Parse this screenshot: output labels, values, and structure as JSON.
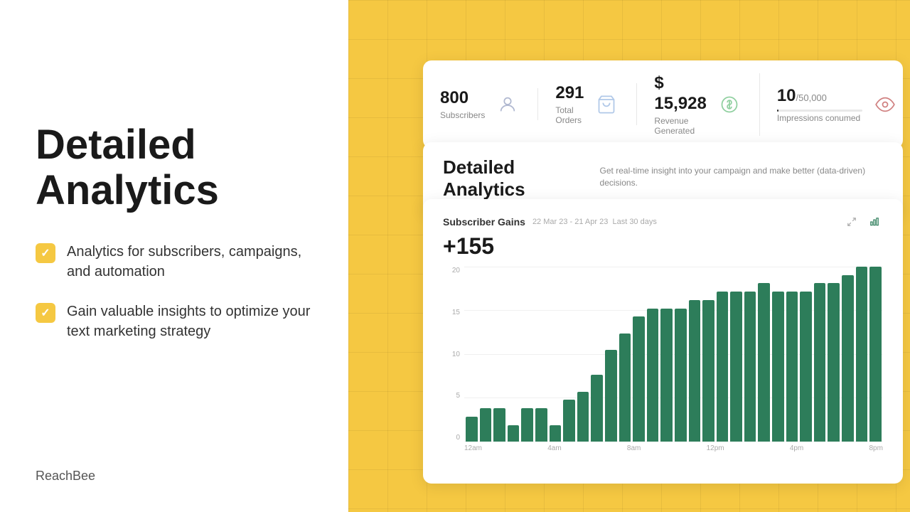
{
  "left": {
    "title": "Detailed\nAnalytics",
    "features": [
      {
        "text": "Analytics for subscribers, campaigns, and automation"
      },
      {
        "text": "Gain valuable insights to optimize your text marketing strategy"
      }
    ],
    "brand": "ReachBee"
  },
  "stats": {
    "subscribers": {
      "value": "800",
      "label": "Subscribers"
    },
    "orders": {
      "value": "291",
      "label": "Total Orders"
    },
    "revenue": {
      "value": "$ 15,928",
      "label": "Revenue Generated"
    },
    "impressions": {
      "value": "10",
      "suffix": "/50,000",
      "label": "Impressions conumed"
    }
  },
  "analytics": {
    "title": "Detailed Analytics",
    "subtitle": "Get real-time insight into your campaign and make better (data-driven) decisions."
  },
  "chart": {
    "title": "Subscriber Gains",
    "dateRange": "22 Mar 23 - 21 Apr 23",
    "period": "Last 30 days",
    "total": "+155",
    "yLabels": [
      "20",
      "15",
      "10",
      "5",
      "0"
    ],
    "xLabels": [
      "12am",
      "4am",
      "8am",
      "12pm",
      "4pm",
      "8pm"
    ],
    "bars": [
      3,
      4,
      4,
      2,
      4,
      4,
      2,
      5,
      6,
      8,
      11,
      13,
      15,
      16,
      16,
      16,
      17,
      17,
      18,
      18,
      18,
      19,
      18,
      18,
      18,
      19,
      19,
      20,
      21,
      21
    ]
  },
  "colors": {
    "yellow": "#F5C842",
    "green": "#2D7D5A",
    "dark": "#1a1a1a"
  }
}
